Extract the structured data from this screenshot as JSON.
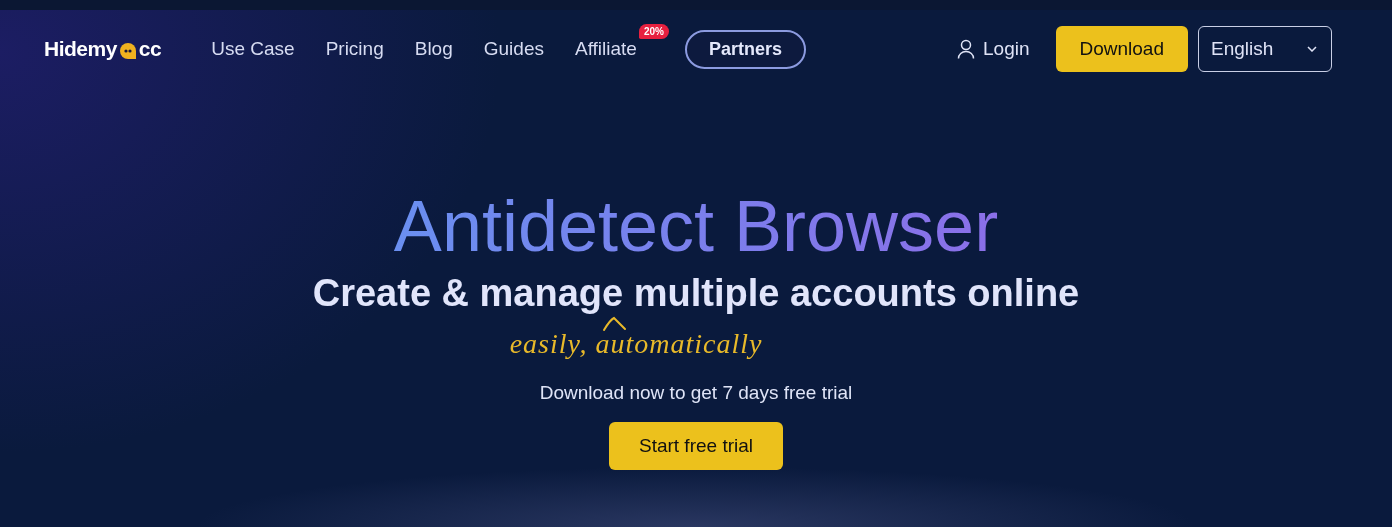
{
  "logo": {
    "before": "Hidemy",
    "after": "cc"
  },
  "nav": [
    {
      "label": "Use Case"
    },
    {
      "label": "Pricing"
    },
    {
      "label": "Blog"
    },
    {
      "label": "Guides"
    },
    {
      "label": "Affiliate",
      "badge": "20%"
    }
  ],
  "partners_button": "Partners",
  "login": "Login",
  "download_button": "Download",
  "language": "English",
  "hero": {
    "title": "Antidetect Browser",
    "subtitle": "Create & manage multiple accounts online",
    "handwritten": "easily, automatically",
    "note": "Download now to get 7 days free trial",
    "cta": "Start free trial"
  }
}
